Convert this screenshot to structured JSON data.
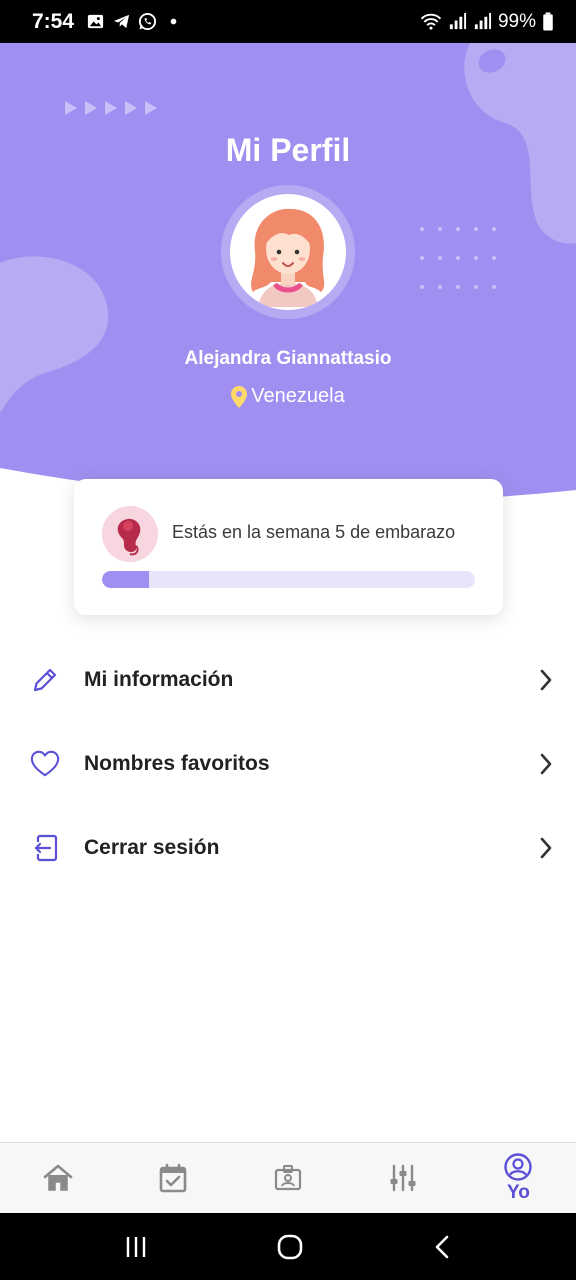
{
  "status_bar": {
    "time": "7:54",
    "battery": "99%",
    "icons": [
      "image-icon",
      "telegram-icon",
      "whatsapp-icon",
      "dot-icon",
      "wifi-icon",
      "signal-icon",
      "signal-icon",
      "battery-icon"
    ]
  },
  "header": {
    "title": "Mi Perfil",
    "user_name": "Alejandra Giannattasio",
    "location": "Venezuela",
    "colors": {
      "background": "#a08ff0",
      "blob": "#b7abf4"
    }
  },
  "progress_card": {
    "text": "Estás en la semana 5 de embarazo",
    "progress_percent": 12.5,
    "colors": {
      "track": "#e8e4fa",
      "fill": "#a08ff0"
    }
  },
  "menu": {
    "items": [
      {
        "label": "Mi información",
        "icon": "pencil-icon"
      },
      {
        "label": "Nombres favoritos",
        "icon": "heart-icon"
      },
      {
        "label": "Cerrar sesión",
        "icon": "logout-icon"
      }
    ]
  },
  "bottom_nav": {
    "items": [
      {
        "icon": "home-icon",
        "label": ""
      },
      {
        "icon": "calendar-check-icon",
        "label": ""
      },
      {
        "icon": "id-badge-icon",
        "label": ""
      },
      {
        "icon": "sliders-icon",
        "label": ""
      },
      {
        "icon": "profile-icon",
        "label": "Yo",
        "active": true
      }
    ],
    "colors": {
      "active": "#5b4fd6",
      "inactive": "#8a8a8a"
    }
  },
  "system_nav": [
    "recents-icon",
    "home-circle-icon",
    "back-icon"
  ]
}
